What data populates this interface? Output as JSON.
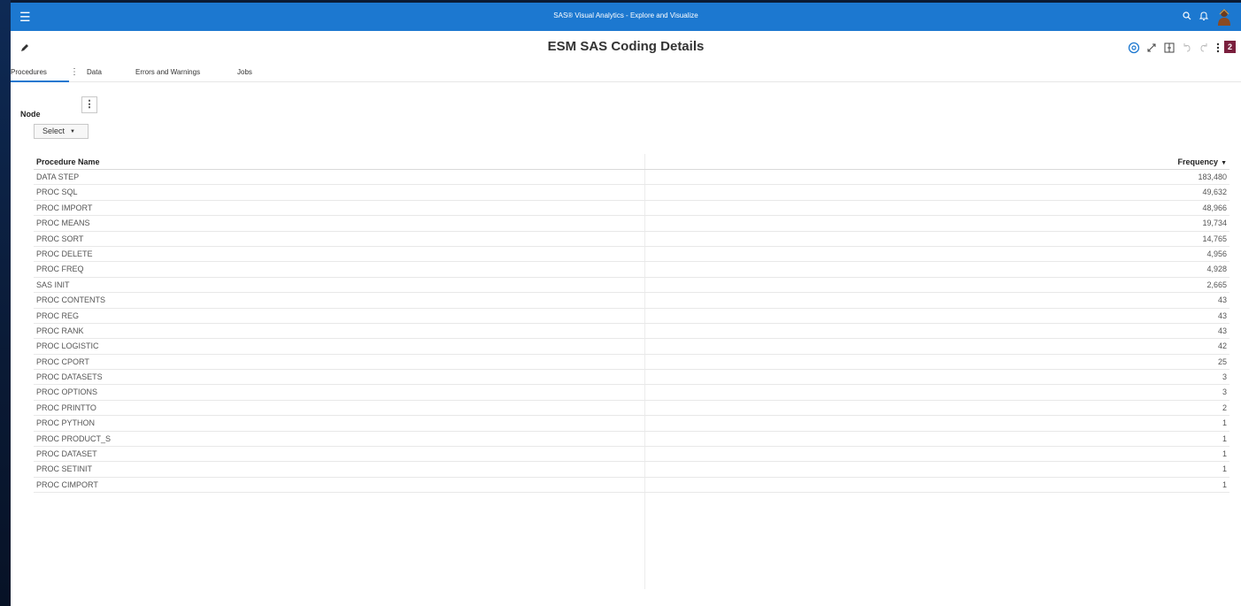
{
  "app": {
    "title": "SAS® Visual Analytics - Explore and Visualize",
    "badge_count": "2",
    "accent_color": "#1c78d0"
  },
  "report": {
    "title": "ESM SAS Coding Details"
  },
  "icons": {
    "menu": "hamburger-icon",
    "search": "search-icon",
    "notifications": "bell-icon",
    "edit": "pencil-icon",
    "help": "help-icon",
    "maximize": "expand-icon",
    "layout": "layout-icon",
    "undo": "undo-icon",
    "redo": "redo-icon",
    "more": "more-vertical-icon"
  },
  "tabs": [
    {
      "label": "Procedures",
      "active": true
    },
    {
      "label": "Data",
      "active": false
    },
    {
      "label": "Errors and Warnings",
      "active": false
    },
    {
      "label": "Jobs",
      "active": false
    }
  ],
  "filter": {
    "label": "Node",
    "select_value": "Select"
  },
  "table": {
    "columns": [
      "Procedure Name",
      "Frequency"
    ],
    "sort_column": "Frequency",
    "sort_direction": "descending",
    "rows": [
      {
        "name": "DATA STEP",
        "frequency": "183,480"
      },
      {
        "name": "PROC SQL",
        "frequency": "49,632"
      },
      {
        "name": "PROC IMPORT",
        "frequency": "48,966"
      },
      {
        "name": "PROC MEANS",
        "frequency": "19,734"
      },
      {
        "name": "PROC SORT",
        "frequency": "14,765"
      },
      {
        "name": "PROC DELETE",
        "frequency": "4,956"
      },
      {
        "name": "PROC FREQ",
        "frequency": "4,928"
      },
      {
        "name": "SAS INIT",
        "frequency": "2,665"
      },
      {
        "name": "PROC CONTENTS",
        "frequency": "43"
      },
      {
        "name": "PROC REG",
        "frequency": "43"
      },
      {
        "name": "PROC RANK",
        "frequency": "43"
      },
      {
        "name": "PROC LOGISTIC",
        "frequency": "42"
      },
      {
        "name": "PROC CPORT",
        "frequency": "25"
      },
      {
        "name": "PROC DATASETS",
        "frequency": "3"
      },
      {
        "name": "PROC OPTIONS",
        "frequency": "3"
      },
      {
        "name": "PROC PRINTTO",
        "frequency": "2"
      },
      {
        "name": "PROC PYTHON",
        "frequency": "1"
      },
      {
        "name": "PROC PRODUCT_S",
        "frequency": "1"
      },
      {
        "name": "PROC DATASET",
        "frequency": "1"
      },
      {
        "name": "PROC SETINIT",
        "frequency": "1"
      },
      {
        "name": "PROC CIMPORT",
        "frequency": "1"
      }
    ]
  }
}
